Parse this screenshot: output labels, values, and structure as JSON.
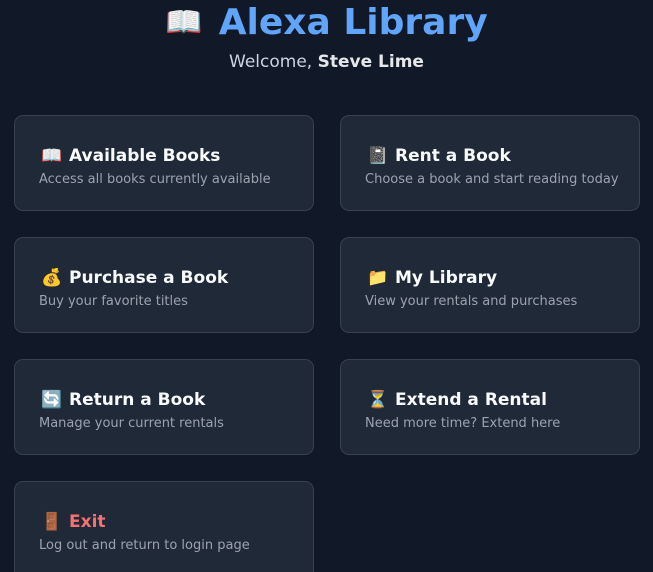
{
  "header": {
    "icon": "📖",
    "icon_name": "open-book-icon",
    "title": "Alexa Library",
    "welcome_prefix": "Welcome, ",
    "username": "Steve Lime"
  },
  "colors": {
    "background": "#111827",
    "card_background": "#1f2937",
    "card_border": "#374151",
    "accent": "#60a5fa",
    "danger": "#f87171"
  },
  "menu": {
    "available": {
      "icon": "📖",
      "icon_name": "open-book-icon",
      "label": "Available Books",
      "desc": "Access all books currently available"
    },
    "rent": {
      "icon": "📓",
      "icon_name": "notebook-icon",
      "label": "Rent a Book",
      "desc": "Choose a book and start reading today"
    },
    "purchase": {
      "icon": "💰",
      "icon_name": "money-bag-icon",
      "label": "Purchase a Book",
      "desc": "Buy your favorite titles"
    },
    "library": {
      "icon": "📁",
      "icon_name": "folder-icon",
      "label": "My Library",
      "desc": "View your rentals and purchases"
    },
    "return": {
      "icon": "🔄",
      "icon_name": "return-arrows-icon",
      "label": "Return a Book",
      "desc": "Manage your current rentals"
    },
    "extend": {
      "icon": "⏳",
      "icon_name": "hourglass-icon",
      "label": "Extend a Rental",
      "desc": "Need more time? Extend here"
    },
    "exit": {
      "icon": "🚪",
      "icon_name": "door-icon",
      "label": "Exit",
      "desc": "Log out and return to login page"
    }
  }
}
